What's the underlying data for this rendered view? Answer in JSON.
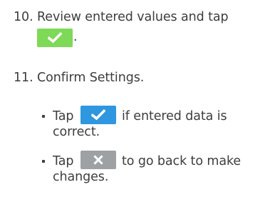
{
  "steps": [
    {
      "number": "10.",
      "text_line1": "Review entered values and tap",
      "text_after_icon": ".",
      "icon": "check-icon",
      "icon_color": "#7ed957"
    },
    {
      "number": "11.",
      "text": "Confirm Settings.",
      "bullets": [
        {
          "prefix": "Tap",
          "icon": "check-icon",
          "icon_color": "#2e97df",
          "text_line1": "if entered data is",
          "text_line2": "correct."
        },
        {
          "prefix": "Tap",
          "icon": "close-icon",
          "icon_color": "#9ea1a4",
          "text_line1": "to go back to make",
          "text_line2": "changes."
        }
      ]
    }
  ]
}
